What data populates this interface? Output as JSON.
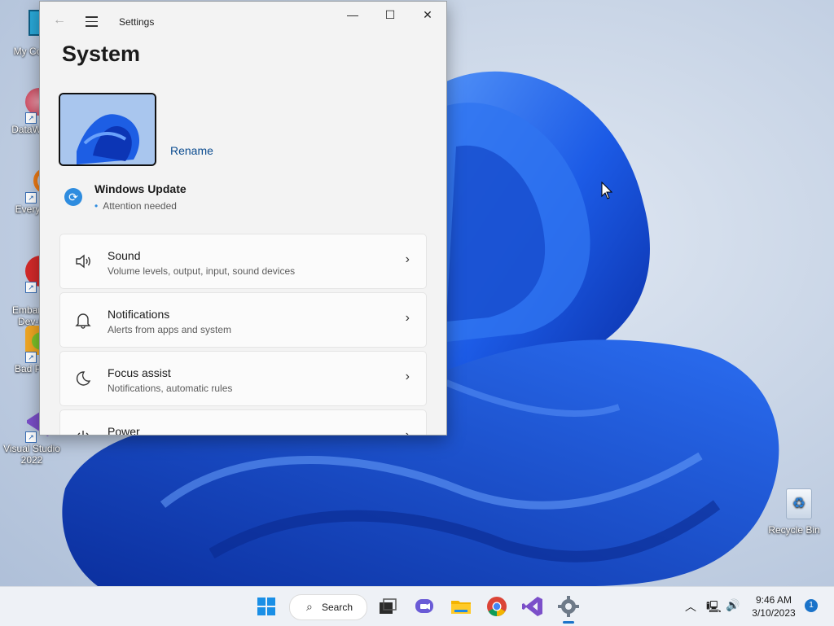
{
  "desktop": {
    "icons": [
      {
        "label": "My Com"
      },
      {
        "label": "DataWag"
      },
      {
        "label": "Everyth"
      },
      {
        "label": "Embarca\nDev-C"
      },
      {
        "label": "Bad Pig"
      },
      {
        "label": "Visual Studio 2022"
      },
      {
        "label": "Recycle Bin"
      }
    ]
  },
  "settings": {
    "app_title": "Settings",
    "page_title": "System",
    "rename_label": "Rename",
    "windows_update": {
      "title": "Windows Update",
      "status": "Attention needed"
    },
    "cards": [
      {
        "title": "Sound",
        "subtitle": "Volume levels, output, input, sound devices",
        "icon": "speaker-icon"
      },
      {
        "title": "Notifications",
        "subtitle": "Alerts from apps and system",
        "icon": "bell-icon"
      },
      {
        "title": "Focus assist",
        "subtitle": "Notifications, automatic rules",
        "icon": "moon-icon"
      },
      {
        "title": "Power",
        "subtitle": "",
        "icon": "power-icon"
      }
    ]
  },
  "taskbar": {
    "search_label": "Search",
    "time": "9:46 AM",
    "date": "3/10/2023",
    "notification_count": "1"
  },
  "colors": {
    "accent": "#1a73c9",
    "wallpaper_blue": "#1f5fe0"
  }
}
